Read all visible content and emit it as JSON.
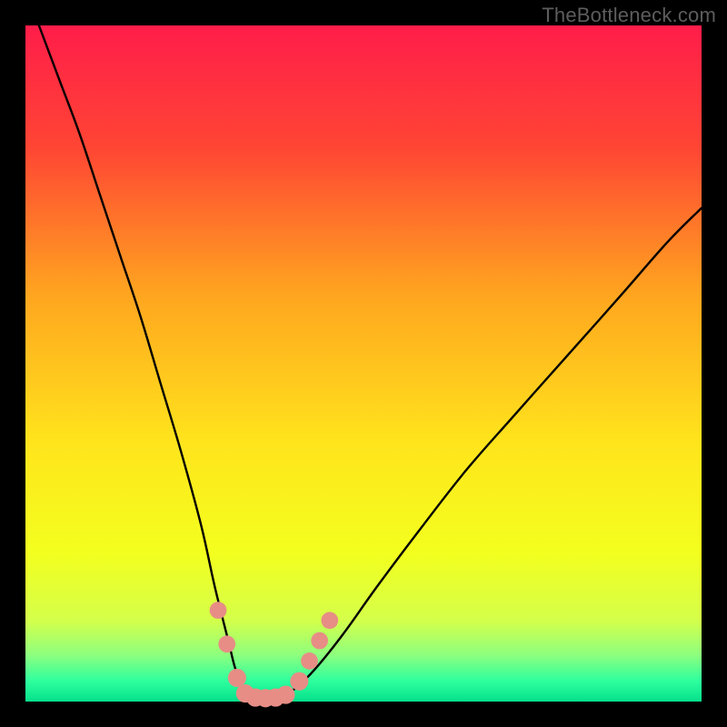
{
  "watermark": "TheBottleneck.com",
  "chart_data": {
    "type": "line",
    "title": "",
    "xlabel": "",
    "ylabel": "",
    "xlim": [
      0,
      100
    ],
    "ylim": [
      0,
      100
    ],
    "grid": false,
    "legend": false,
    "axes_visible": false,
    "background_gradient": {
      "type": "vertical",
      "stops": [
        {
          "pos": 0.0,
          "color": "#ff1d4a"
        },
        {
          "pos": 0.18,
          "color": "#ff4534"
        },
        {
          "pos": 0.4,
          "color": "#ffa61f"
        },
        {
          "pos": 0.62,
          "color": "#ffe51c"
        },
        {
          "pos": 0.78,
          "color": "#f3ff1e"
        },
        {
          "pos": 0.88,
          "color": "#d4ff4a"
        },
        {
          "pos": 0.93,
          "color": "#8fff7d"
        },
        {
          "pos": 0.97,
          "color": "#2dff9e"
        },
        {
          "pos": 1.0,
          "color": "#05e08a"
        }
      ]
    },
    "curve_description": "Asymmetric V-shaped curve resembling a bottleneck chart. Left branch starts at the top-left, drops steeply to a flat minimum near x≈33 at y≈0, then rises more gently toward the upper-right, ending near x≈100 at y≈73.",
    "series": [
      {
        "name": "bottleneck-curve",
        "color": "#000000",
        "x": [
          2,
          5,
          8,
          11,
          14,
          17,
          20,
          23,
          26,
          28,
          30,
          31,
          32,
          33,
          34,
          35,
          36,
          37,
          38,
          40,
          43,
          47,
          52,
          58,
          65,
          72,
          80,
          88,
          95,
          100
        ],
        "y": [
          100,
          92,
          84,
          75,
          66,
          57,
          47,
          37,
          26,
          17,
          9,
          5,
          2.5,
          1.2,
          0.6,
          0.5,
          0.5,
          0.6,
          1.0,
          2.0,
          5,
          10,
          17,
          25,
          34,
          42,
          51,
          60,
          68,
          73
        ]
      }
    ],
    "markers": {
      "description": "Salmon-colored rounded markers clustered around the curve minimum",
      "color": "#e78d86",
      "points": [
        {
          "x": 28.5,
          "y": 13.5,
          "r": 1.4
        },
        {
          "x": 29.8,
          "y": 8.5,
          "r": 1.4
        },
        {
          "x": 31.3,
          "y": 3.5,
          "r": 1.5
        },
        {
          "x": 32.5,
          "y": 1.2,
          "r": 1.5
        },
        {
          "x": 34.0,
          "y": 0.6,
          "r": 1.5
        },
        {
          "x": 35.5,
          "y": 0.5,
          "r": 1.5
        },
        {
          "x": 37.0,
          "y": 0.6,
          "r": 1.5
        },
        {
          "x": 38.5,
          "y": 1.0,
          "r": 1.5
        },
        {
          "x": 40.5,
          "y": 3.0,
          "r": 1.5
        },
        {
          "x": 42.0,
          "y": 6.0,
          "r": 1.4
        },
        {
          "x": 43.5,
          "y": 9.0,
          "r": 1.4
        },
        {
          "x": 45.0,
          "y": 12.0,
          "r": 1.4
        }
      ]
    }
  }
}
